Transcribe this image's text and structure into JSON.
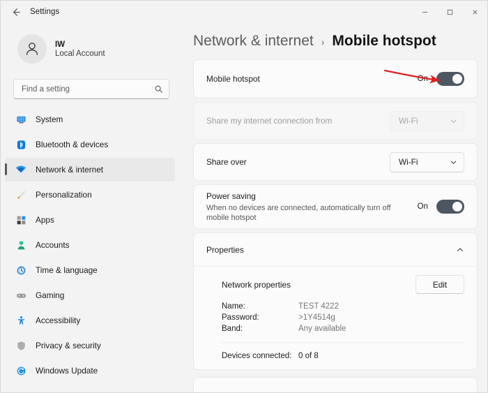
{
  "window": {
    "titlebar": {
      "back_icon": "arrow-left-icon",
      "title": "Settings",
      "minimize_label": "—",
      "maximize_label": "□",
      "close_label": "✕"
    }
  },
  "sidebar": {
    "account": {
      "avatar_icon": "person-icon",
      "name": "IW",
      "subtitle": "Local Account"
    },
    "search": {
      "placeholder": "Find a setting",
      "value": "",
      "icon": "search-icon"
    },
    "items": [
      {
        "label": "System",
        "icon": "monitor-icon",
        "active": false
      },
      {
        "label": "Bluetooth & devices",
        "icon": "bluetooth-icon",
        "active": false
      },
      {
        "label": "Network & internet",
        "icon": "wifi-icon",
        "active": true
      },
      {
        "label": "Personalization",
        "icon": "paintbrush-icon",
        "active": false
      },
      {
        "label": "Apps",
        "icon": "apps-icon",
        "active": false
      },
      {
        "label": "Accounts",
        "icon": "account-icon",
        "active": false
      },
      {
        "label": "Time & language",
        "icon": "clock-icon",
        "active": false
      },
      {
        "label": "Gaming",
        "icon": "gamepad-icon",
        "active": false
      },
      {
        "label": "Accessibility",
        "icon": "accessibility-icon",
        "active": false
      },
      {
        "label": "Privacy & security",
        "icon": "shield-icon",
        "active": false
      },
      {
        "label": "Windows Update",
        "icon": "update-icon",
        "active": false
      }
    ]
  },
  "breadcrumb": {
    "parent": "Network & internet",
    "separator": "›",
    "current": "Mobile hotspot"
  },
  "main": {
    "mobile_hotspot": {
      "title": "Mobile hotspot",
      "state": "On",
      "toggle_on": true
    },
    "share_from": {
      "title": "Share my internet connection from",
      "value": "Wi-Fi",
      "disabled": true,
      "chevron_icon": "chevron-down-icon"
    },
    "share_over": {
      "title": "Share over",
      "value": "Wi-Fi",
      "disabled": false,
      "chevron_icon": "chevron-down-icon"
    },
    "power_saving": {
      "title": "Power saving",
      "description": "When no devices are connected, automatically turn off mobile hotspot",
      "state": "On",
      "toggle_on": true
    },
    "properties": {
      "title": "Properties",
      "chevron_icon": "chevron-up-icon",
      "network_properties_label": "Network properties",
      "edit_label": "Edit",
      "fields": [
        {
          "key": "Name:",
          "value": "TEST 4222"
        },
        {
          "key": "Password:",
          "value": ">1Y4514g"
        },
        {
          "key": "Band:",
          "value": "Any available"
        }
      ],
      "devices": {
        "key": "Devices connected:",
        "value": "0 of 8"
      }
    }
  },
  "annotation": {
    "type": "arrow",
    "color": "#e02020",
    "points_to": "mobile-hotspot-toggle"
  },
  "colors": {
    "toggle_on": "#4d5761",
    "window_bg": "#f3f3f3",
    "card_bg": "#fbfbfb",
    "accent_annotation": "#e02020"
  }
}
